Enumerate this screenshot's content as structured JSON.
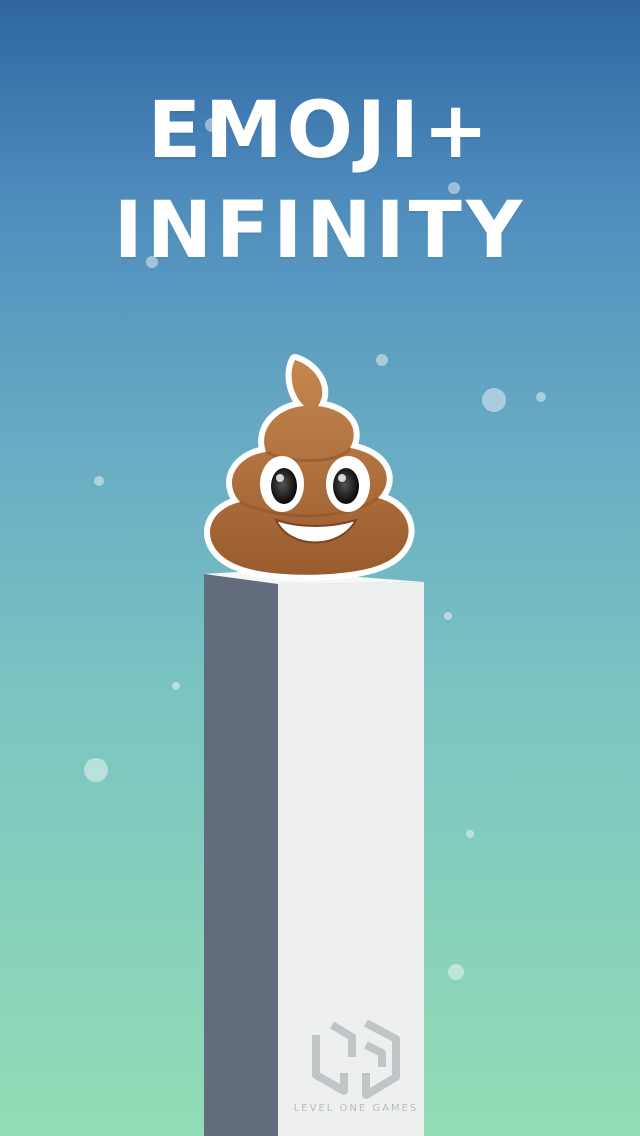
{
  "game": {
    "title_line_1": "EMOJI+",
    "title_line_2": "INFINITY",
    "character_icon": "pile-of-poo-emoji",
    "publisher_logo_text": "LEVEL ONE GAMES"
  },
  "colors": {
    "background_top": "#2f66a2",
    "background_bottom": "#93dcb4",
    "pillar_front": "#eef0f0",
    "pillar_side": "#636c7c",
    "emoji_brown": "#a8683a"
  }
}
